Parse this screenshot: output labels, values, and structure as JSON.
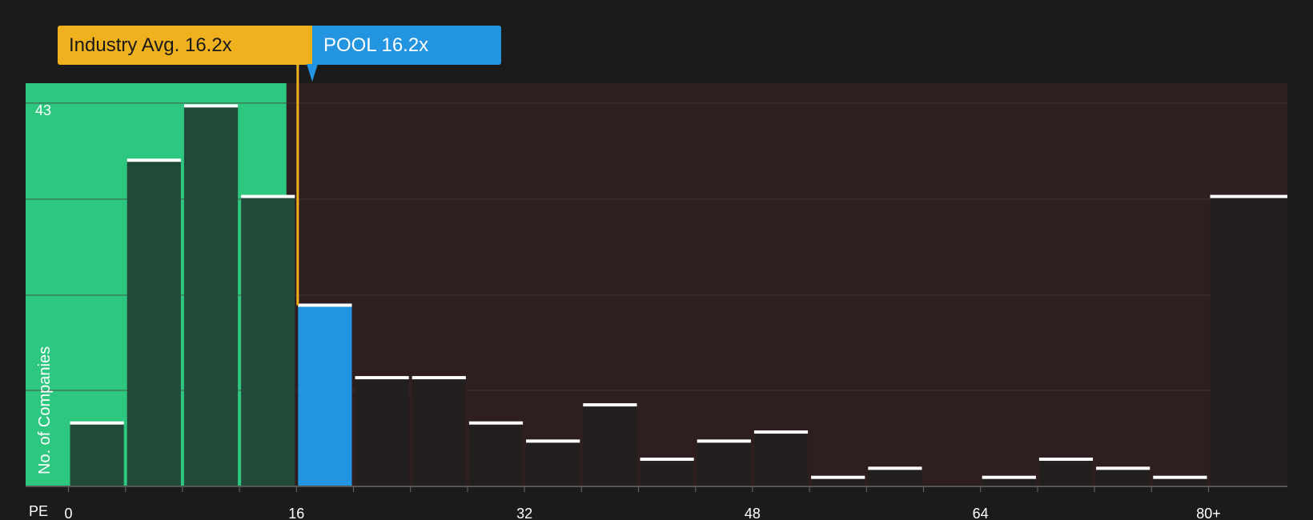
{
  "labels": {
    "industry_avg": "Industry Avg. 16.2x",
    "pool": "POOL 16.2x"
  },
  "colors": {
    "background": "#1b1b1b",
    "below_zone": "#2ec77f",
    "above_zone": "#2f1e1f",
    "bar_dark": "#224a38",
    "bar_plain": "#231f1f",
    "bar_highlight": "#2394e0",
    "industry": "#f0b11f",
    "pool": "#2394e0",
    "cap": "#ffffff",
    "grid": "#4a3a3a",
    "text": "#ffffff"
  },
  "chart_data": {
    "type": "bar",
    "title": "",
    "xlabel": "PE",
    "ylabel": "No. of Companies",
    "bin_width": 4,
    "x_ticks": [
      0,
      16,
      32,
      48,
      64,
      80
    ],
    "x_tick_labels": [
      "0",
      "16",
      "32",
      "48",
      "64",
      "80+"
    ],
    "y_max_label": "43",
    "ylim": [
      0,
      43
    ],
    "y_gridlines": [
      10.6,
      21.1,
      31.7,
      42.3
    ],
    "bins_start": [
      0,
      4,
      8,
      12,
      16,
      20,
      24,
      28,
      32,
      36,
      40,
      44,
      48,
      52,
      56,
      60,
      64,
      68,
      72,
      76,
      80
    ],
    "values": [
      7,
      36,
      42,
      32,
      20,
      12,
      12,
      7,
      5,
      9,
      3,
      5,
      6,
      1,
      2,
      0,
      1,
      3,
      2,
      1,
      32
    ],
    "highlight_bin_start": 16,
    "industry_avg_pe": 16.2,
    "pool_pe": 16.2,
    "grid": true
  }
}
